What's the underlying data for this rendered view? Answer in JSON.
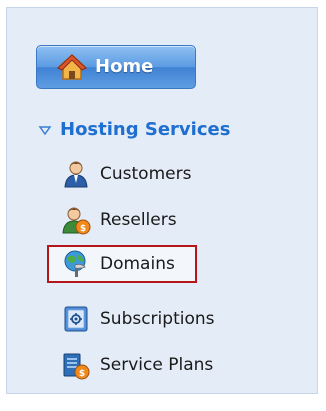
{
  "home": {
    "label": "Home",
    "icon": "home-icon"
  },
  "section": {
    "title": "Hosting Services",
    "expanded": true,
    "toggle_icon": "triangle-down-icon"
  },
  "items": [
    {
      "id": "customers",
      "label": "Customers",
      "icon": "customers-icon",
      "selected": false
    },
    {
      "id": "resellers",
      "label": "Resellers",
      "icon": "resellers-icon",
      "selected": false
    },
    {
      "id": "domains",
      "label": "Domains",
      "icon": "domains-icon",
      "selected": true
    },
    {
      "id": "subscriptions",
      "label": "Subscriptions",
      "icon": "subscriptions-icon",
      "selected": false
    },
    {
      "id": "service_plans",
      "label": "Service Plans",
      "icon": "service-plans-icon",
      "selected": false
    }
  ],
  "colors": {
    "panel_background": "#e3ecf7",
    "section_title": "#1f6fd0",
    "selection_outline": "#b3171a",
    "home_button": "#5b9be3"
  }
}
